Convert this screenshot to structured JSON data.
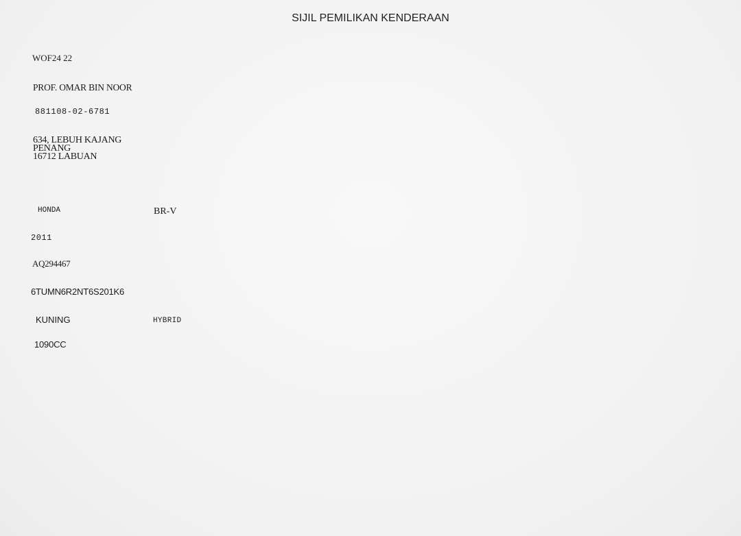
{
  "document": {
    "title": "SIJIL PEMILIKAN KENDERAAN",
    "registration_no": "WOF24 22",
    "owner_name": "PROF. OMAR BIN NOOR",
    "id_no": "881108-02-6781",
    "address": {
      "line1": "634, LEBUH KAJANG",
      "line2": "PENANG",
      "line3": "16712 LABUAN"
    },
    "vehicle": {
      "make": "HONDA",
      "model": "BR-V",
      "year": "2011",
      "engine_no": "AQ294467",
      "chassis_no": "6TUMN6R2NT6S201K6",
      "colour": "KUNING",
      "fuel": "HYBRID",
      "capacity": "1090CC"
    }
  }
}
